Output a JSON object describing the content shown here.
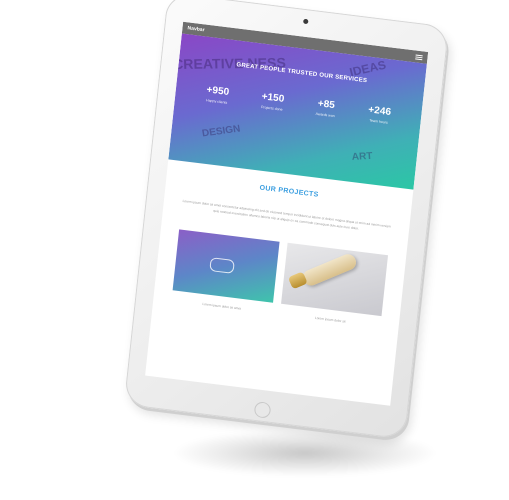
{
  "navbar": {
    "brand": "Navbar"
  },
  "hero": {
    "title": "GREAT PEOPLE TRUSTED OUR SERVICES",
    "bg_words": [
      "CREATIVE NESS",
      "IDEAS",
      "DESIGN",
      "ART"
    ],
    "stats": [
      {
        "value": "+950",
        "label": "Happy clients"
      },
      {
        "value": "+150",
        "label": "Projects done"
      },
      {
        "value": "+85",
        "label": "Awards won"
      },
      {
        "value": "+246",
        "label": "Team hours"
      }
    ]
  },
  "projects": {
    "title": "OUR PROJECTS",
    "description": "Lorem ipsum dolor sit amet consectetur adipiscing elit sed do eiusmod tempor incididunt ut labore et dolore magna aliqua ut enim ad minim veniam quis nostrud exercitation ullamco laboris nisi ut aliquip ex ea commodo consequat duis aute irure dolor.",
    "cards": [
      {
        "caption": "Lorem ipsum dolor sit amet"
      },
      {
        "caption": "Lorem ipsum dolor sit"
      }
    ]
  },
  "colors": {
    "accent": "#3a9ee0",
    "navbar": "#6f6f6f",
    "gradient_start": "#8a47c6",
    "gradient_end": "#2bc7a5"
  }
}
